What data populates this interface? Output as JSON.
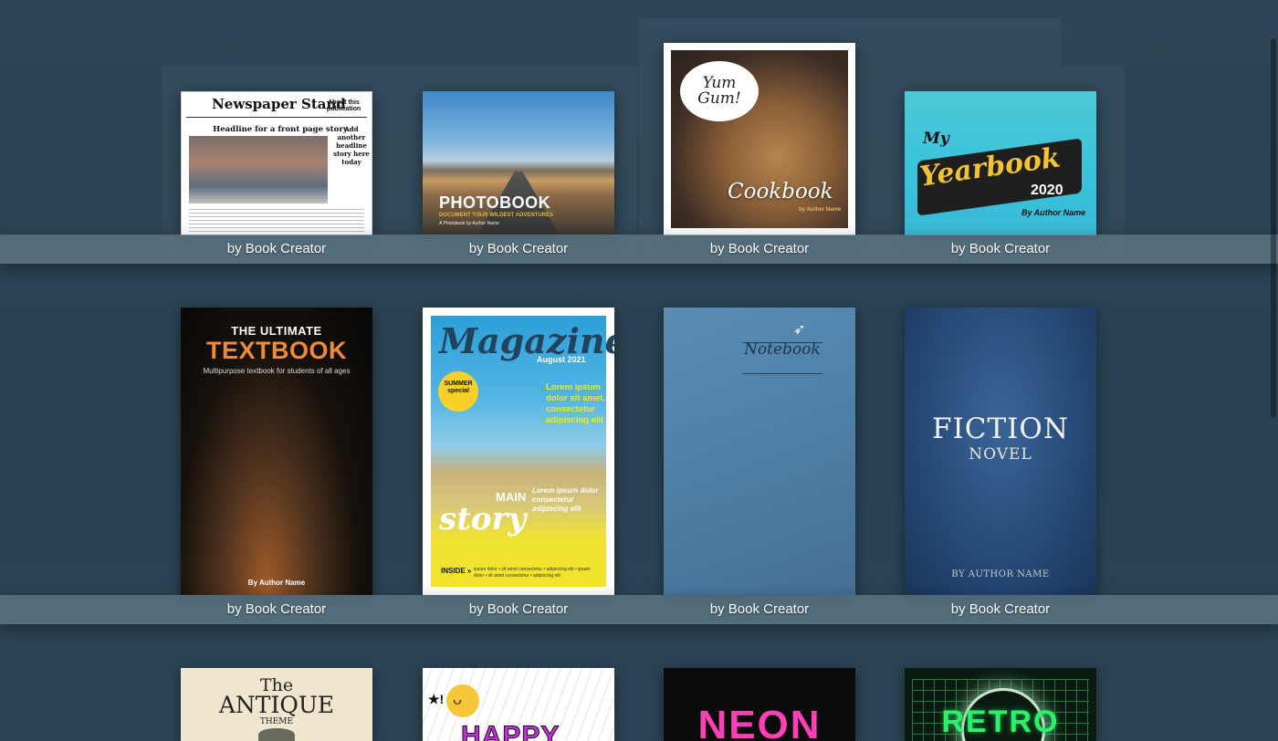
{
  "shelves": [
    {
      "label": "by Book Creator",
      "books": [
        {
          "id": "newspaper",
          "texts": {
            "masthead": "Newspaper Stand",
            "aside": "About this publication",
            "headline": "Headline for a front page story",
            "side_headline": "Add another headline story here today"
          }
        },
        {
          "id": "photobook",
          "texts": {
            "title": "PHOTOBOOK",
            "subtitle": "DOCUMENT YOUR WILDEST ADVENTURES",
            "byline": "A Photobook by Author Name"
          }
        },
        {
          "id": "cookbook",
          "texts": {
            "bubble": "Yum Gum!",
            "title": "Cookbook",
            "author": "by Author Name"
          }
        },
        {
          "id": "yearbook",
          "texts": {
            "my": "My",
            "title": "Yearbook",
            "year": "2020",
            "author": "By Author Name"
          }
        }
      ]
    },
    {
      "label": "by Book Creator",
      "books": [
        {
          "id": "textbook",
          "texts": {
            "line1": "THE ULTIMATE",
            "title": "TEXTBOOK",
            "subtitle": "Multipurpose textbook for students of all ages",
            "author": "By Author Name"
          }
        },
        {
          "id": "magazine",
          "texts": {
            "title": "Magazine",
            "date": "August 2021",
            "badge": "SUMMER special",
            "lorem": "Lorem ipsum dolor sit amet, consectetur adipiscing elit",
            "main": "MAIN",
            "story": "story",
            "lorem2": "Lorem ipsum dolor consectetur adipiscing elit",
            "inside": "INSIDE »",
            "inside_text": "ipsum dolor • sit amet consectetur • adipiscing elit • ipsum dolor • sit amet consectetur • adipiscing elit"
          }
        },
        {
          "id": "notebook",
          "texts": {
            "title": "Notebook"
          }
        },
        {
          "id": "fiction",
          "texts": {
            "title": "FICTION",
            "subtitle": "NOVEL",
            "author": "BY AUTHOR NAME"
          }
        }
      ]
    },
    {
      "label": "",
      "books": [
        {
          "id": "antique",
          "texts": {
            "the": "The",
            "title": "ANTIQUE",
            "theme": "THEME"
          }
        },
        {
          "id": "happy",
          "texts": {
            "title": "HAPPY"
          }
        },
        {
          "id": "neon",
          "texts": {
            "title": "NEON"
          }
        },
        {
          "id": "retro",
          "texts": {
            "title": "RETRO"
          }
        }
      ]
    }
  ]
}
